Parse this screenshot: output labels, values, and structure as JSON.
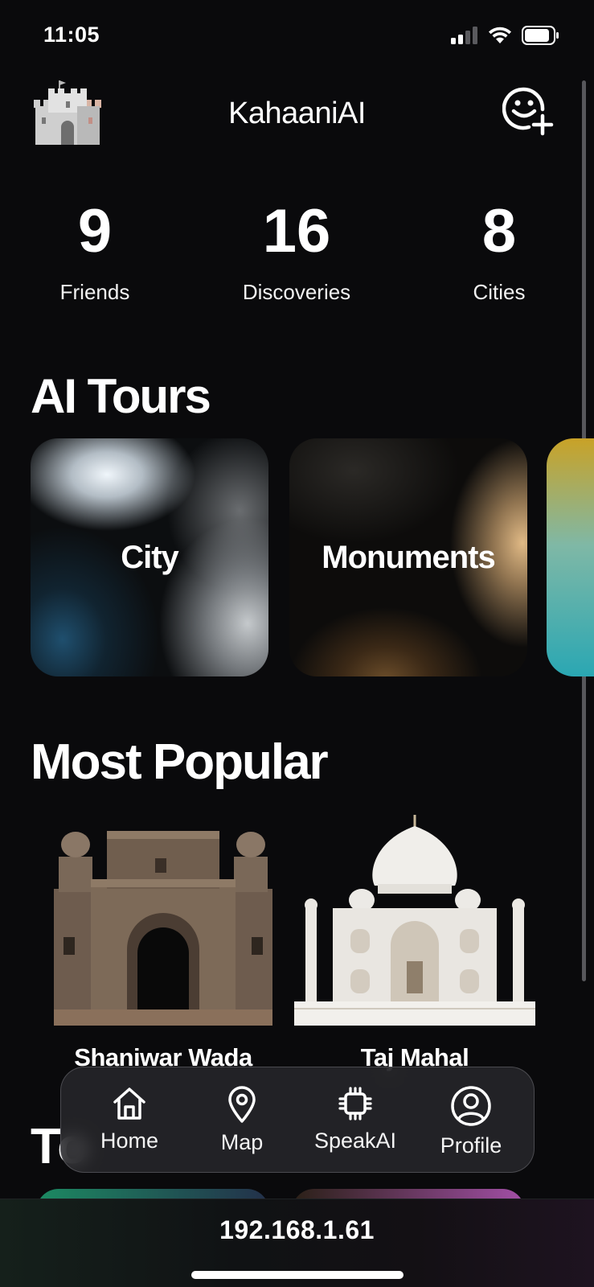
{
  "status_bar": {
    "time": "11:05"
  },
  "header": {
    "title": "KahaaniAI"
  },
  "stats": [
    {
      "value": "9",
      "label": "Friends"
    },
    {
      "value": "16",
      "label": "Discoveries"
    },
    {
      "value": "8",
      "label": "Cities"
    }
  ],
  "ai_tours": {
    "title": "AI Tours",
    "cards": [
      {
        "label": "City"
      },
      {
        "label": "Monuments"
      }
    ]
  },
  "most_popular": {
    "title": "Most Popular",
    "items": [
      {
        "label": "Shaniwar Wada"
      },
      {
        "label": "Taj Mahal"
      }
    ]
  },
  "next_section": {
    "title_fragment": "To"
  },
  "bottom_nav": {
    "items": [
      {
        "label": "Home",
        "icon": "home-icon"
      },
      {
        "label": "Map",
        "icon": "map-pin-icon"
      },
      {
        "label": "SpeakAI",
        "icon": "chip-icon"
      },
      {
        "label": "Profile",
        "icon": "profile-icon"
      }
    ]
  },
  "browser": {
    "url": "192.168.1.61"
  }
}
